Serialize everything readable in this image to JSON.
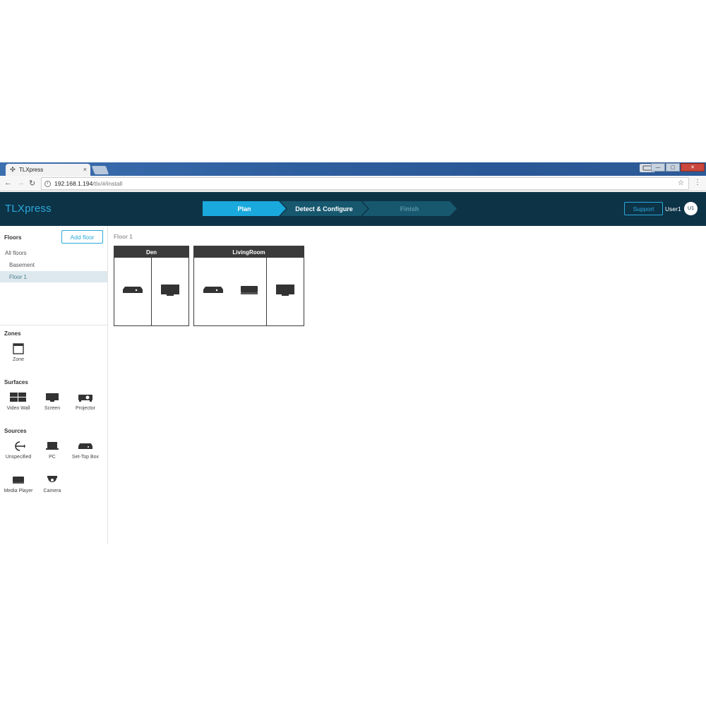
{
  "browser": {
    "tab_title": "TLXpress",
    "tab_close": "×",
    "url_host": "192.168.1.194",
    "url_path": "/tlx/#/install",
    "user_badge": "",
    "win_min": "—",
    "win_max": "▢",
    "win_close": "✕"
  },
  "header": {
    "brand": "TLXpress",
    "steps": [
      {
        "label": "Plan",
        "state": "active"
      },
      {
        "label": "Detect & Configure",
        "state": "pending"
      },
      {
        "label": "Finish",
        "state": "disabled"
      }
    ],
    "support_label": "Support",
    "user_name": "User1",
    "avatar_initials": "U1",
    "colors": {
      "accent": "#1aa9dd",
      "header_bg": "#0d3347",
      "step_inactive": "#17586f"
    }
  },
  "sidebar": {
    "floors_title": "Floors",
    "add_floor_label": "Add floor",
    "floors": [
      {
        "label": "All floors",
        "selected": false,
        "indent": false
      },
      {
        "label": "Basement",
        "selected": false,
        "indent": true
      },
      {
        "label": "Floor 1",
        "selected": true,
        "indent": true
      }
    ],
    "zones_title": "Zones",
    "zones_tools": [
      {
        "label": "Zone",
        "icon": "zone-icon"
      }
    ],
    "surfaces_title": "Surfaces",
    "surfaces_tools": [
      {
        "label": "Video Wall",
        "icon": "video-wall-icon"
      },
      {
        "label": "Screen",
        "icon": "screen-icon"
      },
      {
        "label": "Projector",
        "icon": "projector-icon"
      }
    ],
    "sources_title": "Sources",
    "sources_tools": [
      {
        "label": "Unspecified",
        "icon": "unspecified-source-icon"
      },
      {
        "label": "PC",
        "icon": "laptop-icon"
      },
      {
        "label": "Set-Top Box",
        "icon": "set-top-box-icon"
      },
      {
        "label": "Media Player",
        "icon": "media-player-icon"
      },
      {
        "label": "Camera",
        "icon": "camera-icon"
      }
    ]
  },
  "main": {
    "floor_label": "Floor 1",
    "zones": [
      {
        "name": "Den",
        "devices": [
          [
            "set-top-box-icon"
          ],
          [
            "screen-icon"
          ]
        ]
      },
      {
        "name": "LivingRoom",
        "devices": [
          [
            "set-top-box-icon",
            "media-player-icon"
          ],
          [
            "screen-icon"
          ]
        ]
      }
    ]
  }
}
